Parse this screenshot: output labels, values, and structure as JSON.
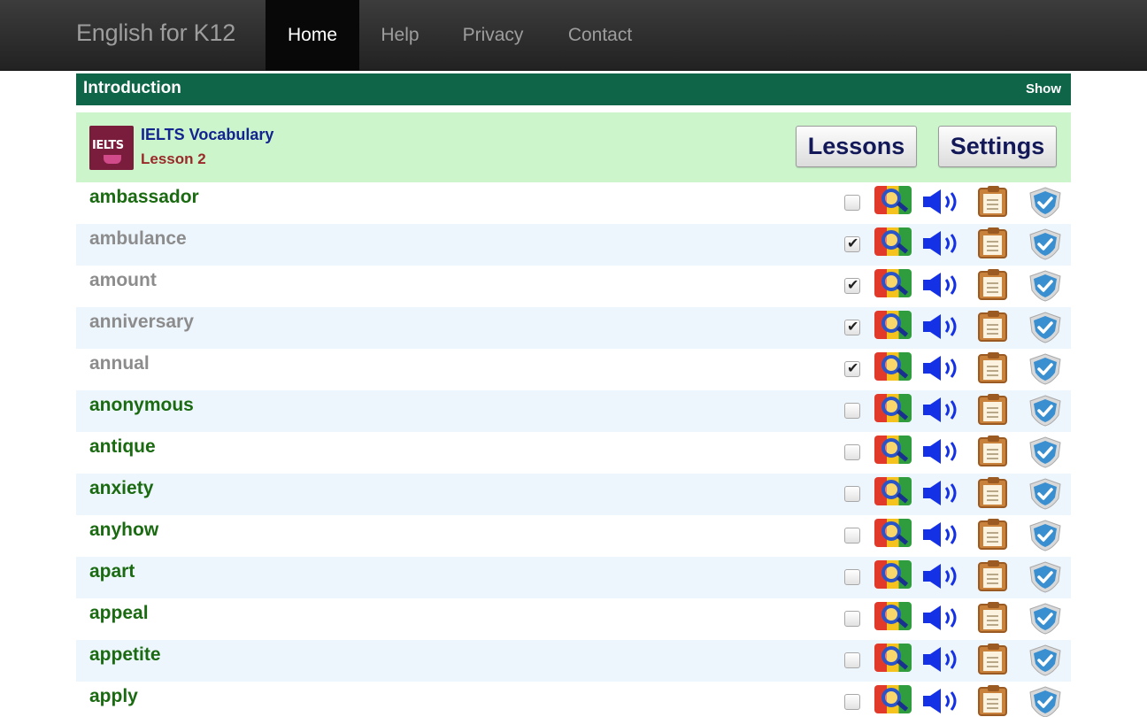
{
  "navbar": {
    "brand": "English for K12",
    "items": [
      {
        "label": "Home",
        "active": true
      },
      {
        "label": "Help",
        "active": false
      },
      {
        "label": "Privacy",
        "active": false
      },
      {
        "label": "Contact",
        "active": false
      }
    ]
  },
  "intro": {
    "title": "Introduction",
    "toggle_label": "Show",
    "color": "#0e6548"
  },
  "lesson": {
    "logo_text": "IELTS",
    "title": "IELTS Vocabulary",
    "subtitle": "Lesson 2",
    "lessons_button": "Lessons",
    "settings_button": "Settings",
    "background": "#ccf5cc"
  },
  "row_icons": [
    "checkbox",
    "search-icon",
    "speaker-icon",
    "clipboard-icon",
    "shield-check-icon"
  ],
  "words": [
    {
      "word": "ambassador",
      "checked": false
    },
    {
      "word": "ambulance",
      "checked": true
    },
    {
      "word": "amount",
      "checked": true
    },
    {
      "word": "anniversary",
      "checked": true
    },
    {
      "word": "annual",
      "checked": true
    },
    {
      "word": "anonymous",
      "checked": false
    },
    {
      "word": "antique",
      "checked": false
    },
    {
      "word": "anxiety",
      "checked": false
    },
    {
      "word": "anyhow",
      "checked": false
    },
    {
      "word": "apart",
      "checked": false
    },
    {
      "word": "appeal",
      "checked": false
    },
    {
      "word": "appetite",
      "checked": false
    },
    {
      "word": "apply",
      "checked": false
    }
  ],
  "colors": {
    "word_active": "#1a6a11",
    "word_done": "#8c8c8c",
    "row_alt": "#eef6fd",
    "button_text": "#121858"
  }
}
